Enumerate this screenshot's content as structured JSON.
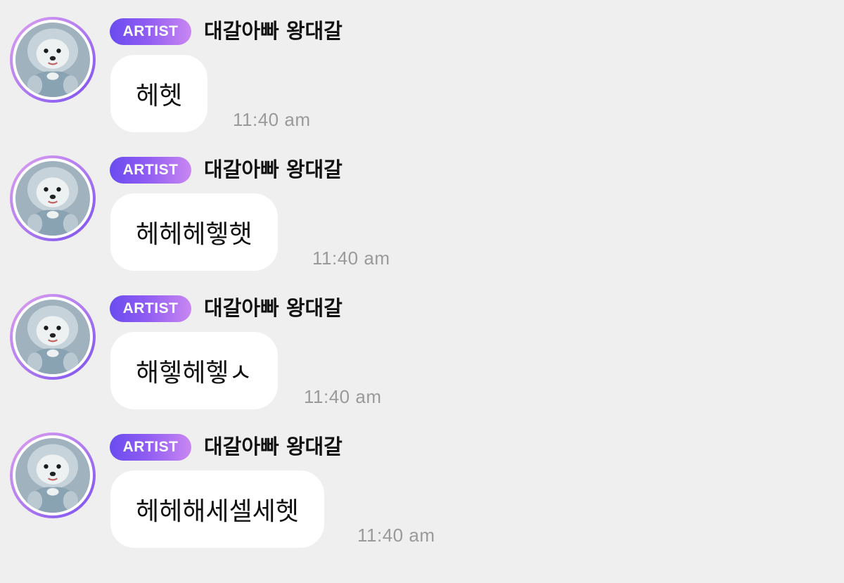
{
  "messages": [
    {
      "badge": "ARTIST",
      "sender": "대갈아빠 왕대갈",
      "text": "헤헷",
      "time": "11:40 am"
    },
    {
      "badge": "ARTIST",
      "sender": "대갈아빠 왕대갈",
      "text": "헤헤헤헿햇",
      "time": "11:40 am"
    },
    {
      "badge": "ARTIST",
      "sender": "대갈아빠 왕대갈",
      "text": "해헿헤헿ㅅ",
      "time": "11:40 am"
    },
    {
      "badge": "ARTIST",
      "sender": "대갈아빠 왕대갈",
      "text": "헤헤해세셀세헷",
      "time": "11:40 am"
    }
  ],
  "colors": {
    "background": "#efefef",
    "bubble": "#ffffff",
    "badge_start": "#6a4cf0",
    "badge_end": "#c987f2",
    "timestamp": "#9a9a9a"
  },
  "icons": {
    "avatar": "fluffy-dog-in-blue-hoodie-avatar"
  }
}
